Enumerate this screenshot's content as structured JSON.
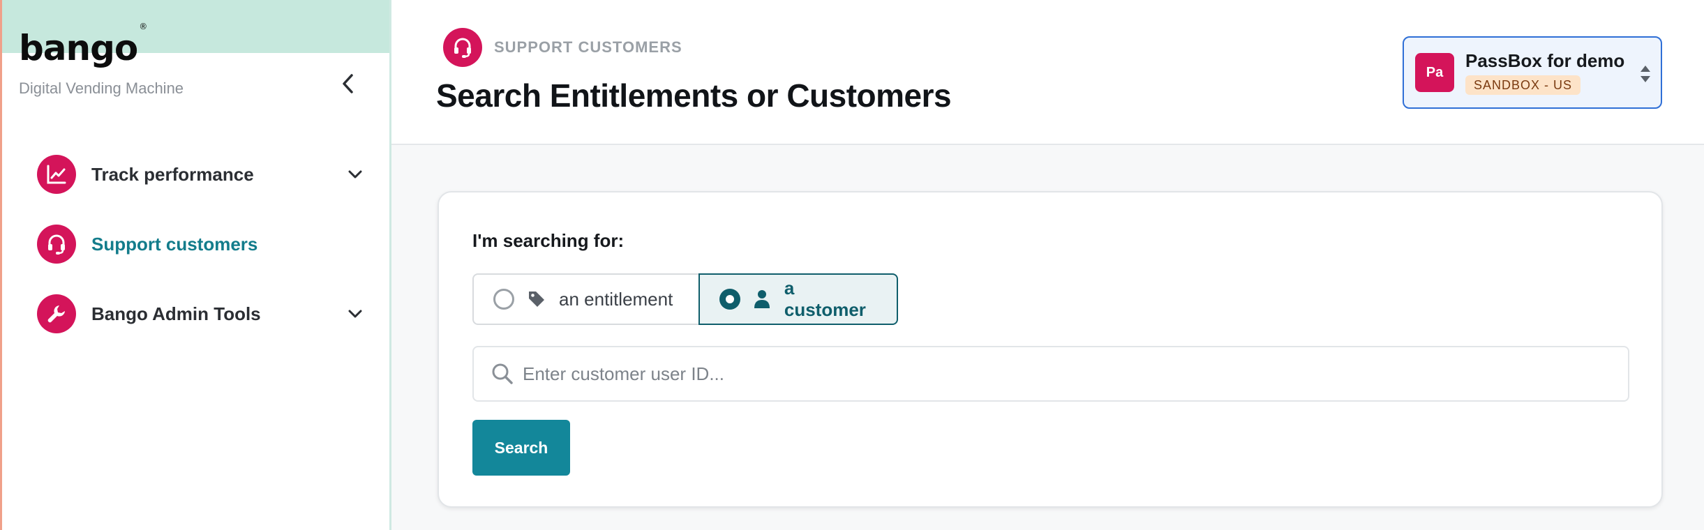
{
  "sidebar": {
    "logo": "bango",
    "logo_mark": "®",
    "tagline": "Digital Vending Machine",
    "collapse_icon": "chevron-left-icon",
    "items": [
      {
        "label": "Track performance",
        "icon": "chart-line-icon",
        "expandable": true,
        "active": false
      },
      {
        "label": "Support customers",
        "icon": "headset-icon",
        "expandable": false,
        "active": true
      },
      {
        "label": "Bango Admin Tools",
        "icon": "wrench-icon",
        "expandable": true,
        "active": false
      }
    ]
  },
  "header": {
    "section": "SUPPORT CUSTOMERS",
    "section_icon": "headset-icon",
    "title": "Search Entitlements or Customers"
  },
  "account": {
    "avatar": "Pa",
    "name": "PassBox for demo",
    "environment": "SANDBOX - US",
    "switch_icon": "sort-icon"
  },
  "search_card": {
    "label": "I'm searching for:",
    "options": [
      {
        "label": "an entitlement",
        "icon": "tag-icon",
        "selected": false
      },
      {
        "label": "a customer",
        "icon": "user-icon",
        "selected": true
      }
    ],
    "input_placeholder": "Enter customer user ID...",
    "input_value": "",
    "button_label": "Search"
  },
  "colors": {
    "brand": "#d4145a",
    "accent": "#13879a",
    "selected": "#0f5e6b",
    "sidebar_band": "#c6e8dd",
    "account_border": "#2f6fd6",
    "badge_bg": "#fde3c8"
  }
}
